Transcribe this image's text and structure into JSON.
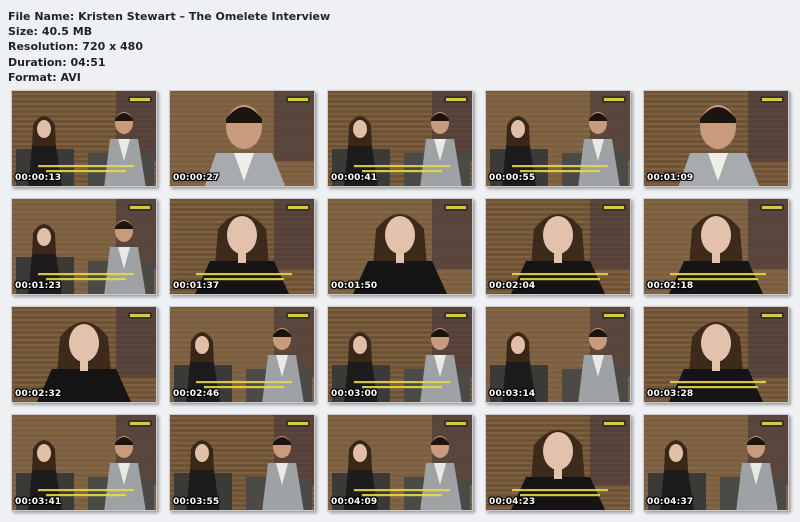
{
  "file_info": {
    "file_name_label": "File Name:",
    "file_name": "Kristen Stewart – The Omelete Interview",
    "size_label": "Size:",
    "size": "40.5 MB",
    "resolution_label": "Resolution:",
    "resolution": "720 x 480",
    "duration_label": "Duration:",
    "duration": "04:51",
    "format_label": "Format:",
    "format": "AVI"
  },
  "thumbnails": [
    {
      "timestamp": "00:00:13",
      "scene": "both"
    },
    {
      "timestamp": "00:00:27",
      "scene": "man-close"
    },
    {
      "timestamp": "00:00:41",
      "scene": "both"
    },
    {
      "timestamp": "00:00:55",
      "scene": "both"
    },
    {
      "timestamp": "00:01:09",
      "scene": "man-close"
    },
    {
      "timestamp": "00:01:23",
      "scene": "both"
    },
    {
      "timestamp": "00:01:37",
      "scene": "woman-close"
    },
    {
      "timestamp": "00:01:50",
      "scene": "woman-close"
    },
    {
      "timestamp": "00:02:04",
      "scene": "woman-close"
    },
    {
      "timestamp": "00:02:18",
      "scene": "woman-close"
    },
    {
      "timestamp": "00:02:32",
      "scene": "woman-close"
    },
    {
      "timestamp": "00:02:46",
      "scene": "both"
    },
    {
      "timestamp": "00:03:00",
      "scene": "both"
    },
    {
      "timestamp": "00:03:14",
      "scene": "both"
    },
    {
      "timestamp": "00:03:28",
      "scene": "woman-close"
    },
    {
      "timestamp": "00:03:41",
      "scene": "both"
    },
    {
      "timestamp": "00:03:55",
      "scene": "both"
    },
    {
      "timestamp": "00:04:09",
      "scene": "both"
    },
    {
      "timestamp": "00:04:23",
      "scene": "woman-close"
    },
    {
      "timestamp": "00:04:37",
      "scene": "both"
    }
  ],
  "colors": {
    "background": "#eef0f4",
    "subtitle": "#e8d84a",
    "timestamp": "#ffffff"
  }
}
